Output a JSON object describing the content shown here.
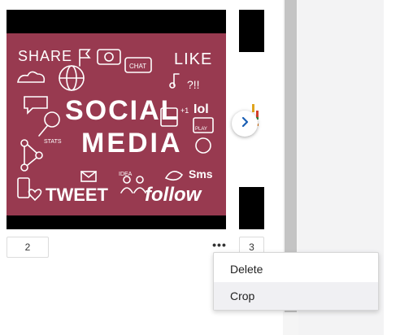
{
  "slides": [
    {
      "page_number": "2",
      "image": {
        "texts": {
          "share": "SHARE",
          "like": "LIKE",
          "chat": "CHAT",
          "social": "SOCIAL",
          "media": "MEDIA",
          "tweet": "TWEET",
          "follow": "follow",
          "play": "PLAY",
          "stats": "STATS",
          "idea": "IDEA",
          "sms": "Sms",
          "plus": "+1",
          "qmark": "?!!",
          "iol": "Iol"
        },
        "colors": {
          "background": "#983a50",
          "foreground": "#ffffff",
          "letterbox": "#000000"
        }
      }
    },
    {
      "page_number": "3"
    }
  ],
  "navigation": {
    "next_icon": "chevron-right-icon"
  },
  "more_menu": {
    "trigger": "•••",
    "items": [
      {
        "label": "Delete"
      },
      {
        "label": "Crop"
      }
    ]
  }
}
